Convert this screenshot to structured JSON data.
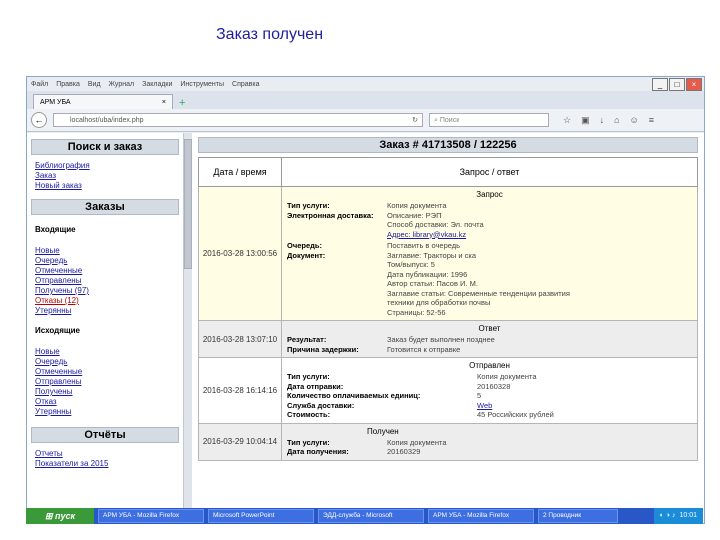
{
  "slide_title": "Заказ получен",
  "browser": {
    "menu": [
      "Файл",
      "Правка",
      "Вид",
      "Журнал",
      "Закладки",
      "Инструменты",
      "Справка"
    ],
    "tab_label": "АРМ УБА",
    "url": "localhost/uba/index.php",
    "search_placeholder": "Поиск"
  },
  "sidebar": {
    "search_header": "Поиск и заказ",
    "search_links": [
      "Библиография",
      "Заказ",
      "Новый заказ"
    ],
    "orders_header": "Заказы",
    "incoming_title": "Входящие",
    "incoming_links": [
      "Новые",
      "Очередь",
      "Отмеченные",
      "Отправлены",
      "Получены (97)",
      "Отказы (12)",
      "Утерянны"
    ],
    "outgoing_title": "Исходящие",
    "outgoing_links": [
      "Новые",
      "Очередь",
      "Отмеченные",
      "Отправлены",
      "Получены",
      "Отказ",
      "Утерянны"
    ],
    "reports_header": "Отчёты",
    "reports_links": [
      "Отчеты",
      "Показатели за 2015"
    ]
  },
  "main": {
    "order_title": "Заказ # 41713508 / 122256",
    "col_date": "Дата / время",
    "col_request": "Запрос / ответ",
    "rows": [
      {
        "date": "2016-03-28 13:00:56",
        "title": "Запрос",
        "fields": [
          {
            "k": "Тип услуги:",
            "v": "Копия документа"
          },
          {
            "k": "Электронная доставка:",
            "v": "Описание: РЭП"
          },
          {
            "k": "",
            "v": "Способ доставки: Эл. почта"
          },
          {
            "k": "",
            "v": "Адрес: library@vkau.kz"
          },
          {
            "k": "Очередь:",
            "v": "Поставить в очередь"
          },
          {
            "k": "Документ:",
            "v": "Заглавие: Тракторы и ска"
          },
          {
            "k": "",
            "v": "Том/выпуск: 5"
          },
          {
            "k": "",
            "v": "Дата публикации: 1996"
          },
          {
            "k": "",
            "v": "Автор статьи: Пасов И. М."
          },
          {
            "k": "",
            "v": "Заглавие статьи: Современные тенденции развития"
          },
          {
            "k": "",
            "v": "техники для обработки почвы"
          },
          {
            "k": "",
            "v": "Страницы: 52-56"
          }
        ]
      },
      {
        "date": "2016-03-28 13:07:10",
        "title": "Ответ",
        "fields": [
          {
            "k": "Результат:",
            "v": "Заказ будет выполнен позднее"
          },
          {
            "k": "Причина задержки:",
            "v": "Готовится к отправке"
          }
        ]
      },
      {
        "date": "2016-03-28 16:14:16",
        "title": "Отправлен",
        "fields": [
          {
            "k": "Тип услуги:",
            "v": "Копия документа"
          },
          {
            "k": "Дата отправки:",
            "v": "20160328"
          },
          {
            "k": "Количество оплачиваемых единиц:",
            "v": "5"
          },
          {
            "k": "Служба доставки:",
            "v": "Web"
          },
          {
            "k": "Стоимость:",
            "v": "45 Российских рублей"
          }
        ]
      },
      {
        "date": "2016-03-29 10:04:14",
        "title": "Получен",
        "fields": [
          {
            "k": "Тип услуги:",
            "v": "Копия документа"
          },
          {
            "k": "Дата получения:",
            "v": "20160329"
          }
        ]
      }
    ]
  },
  "taskbar": {
    "start_label": "пуск",
    "items": [
      "АРМ УБА - Mozilla Firefox",
      "Microsoft PowerPoint",
      "ЭДД-служба - Microsoft",
      "АРМ УБА - Mozilla Firefox",
      "2 Проводник"
    ],
    "clock": "10:01"
  }
}
